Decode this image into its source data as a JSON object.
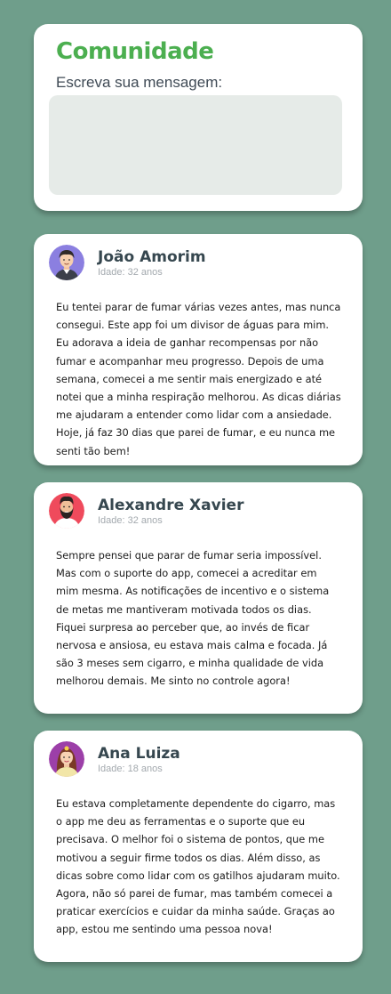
{
  "compose": {
    "title": "Comunidade",
    "label": "Escreva sua mensagem:",
    "message_value": ""
  },
  "posts": [
    {
      "name": "João Amorim",
      "age": "Idade: 32 anos",
      "avatar_icon": "male-user-avatar-icon",
      "avatar_bg": "#8b7fe0",
      "text": "Eu tentei parar de fumar várias vezes antes, mas nunca consegui. Este app foi um divisor de águas para mim. Eu adorava a ideia de ganhar recompensas por não fumar e acompanhar meu progresso. Depois de uma semana, comecei a me sentir mais energizado e até notei que a minha respiração melhorou. As dicas diárias me ajudaram a entender como lidar com a ansiedade. Hoje, já faz 30 dias que parei de fumar, e eu nunca me senti tão bem!"
    },
    {
      "name": "Alexandre Xavier",
      "age": "Idade: 32 anos",
      "avatar_icon": "bearded-male-avatar-icon",
      "avatar_bg": "#ef4a5c",
      "text": "Sempre pensei que parar de fumar seria impossível. Mas com o suporte do app, comecei a acreditar em mim mesma. As notificações de incentivo e o sistema de metas me mantiveram motivada todos os dias. Fiquei surpresa ao perceber que, ao invés de ficar nervosa e ansiosa, eu estava mais calma e focada. Já são 3 meses sem cigarro, e minha qualidade de vida melhorou demais. Me sinto no controle agora!"
    },
    {
      "name": "Ana Luiza",
      "age": "Idade: 18 anos",
      "avatar_icon": "female-avatar-icon",
      "avatar_bg": "#9c3fa8",
      "text": "Eu estava completamente dependente do cigarro, mas o app me deu as ferramentas e o suporte que eu precisava. O melhor foi o sistema de pontos, que me motivou a seguir firme todos os dias. Além disso, as dicas sobre como lidar com os gatilhos ajudaram muito. Agora, não só parei de fumar, mas também comecei a praticar exercícios e cuidar da minha saúde. Graças ao app, estou me sentindo uma pessoa nova!"
    }
  ],
  "colors": {
    "background": "#6f9e8b",
    "accent": "#4caf50"
  }
}
